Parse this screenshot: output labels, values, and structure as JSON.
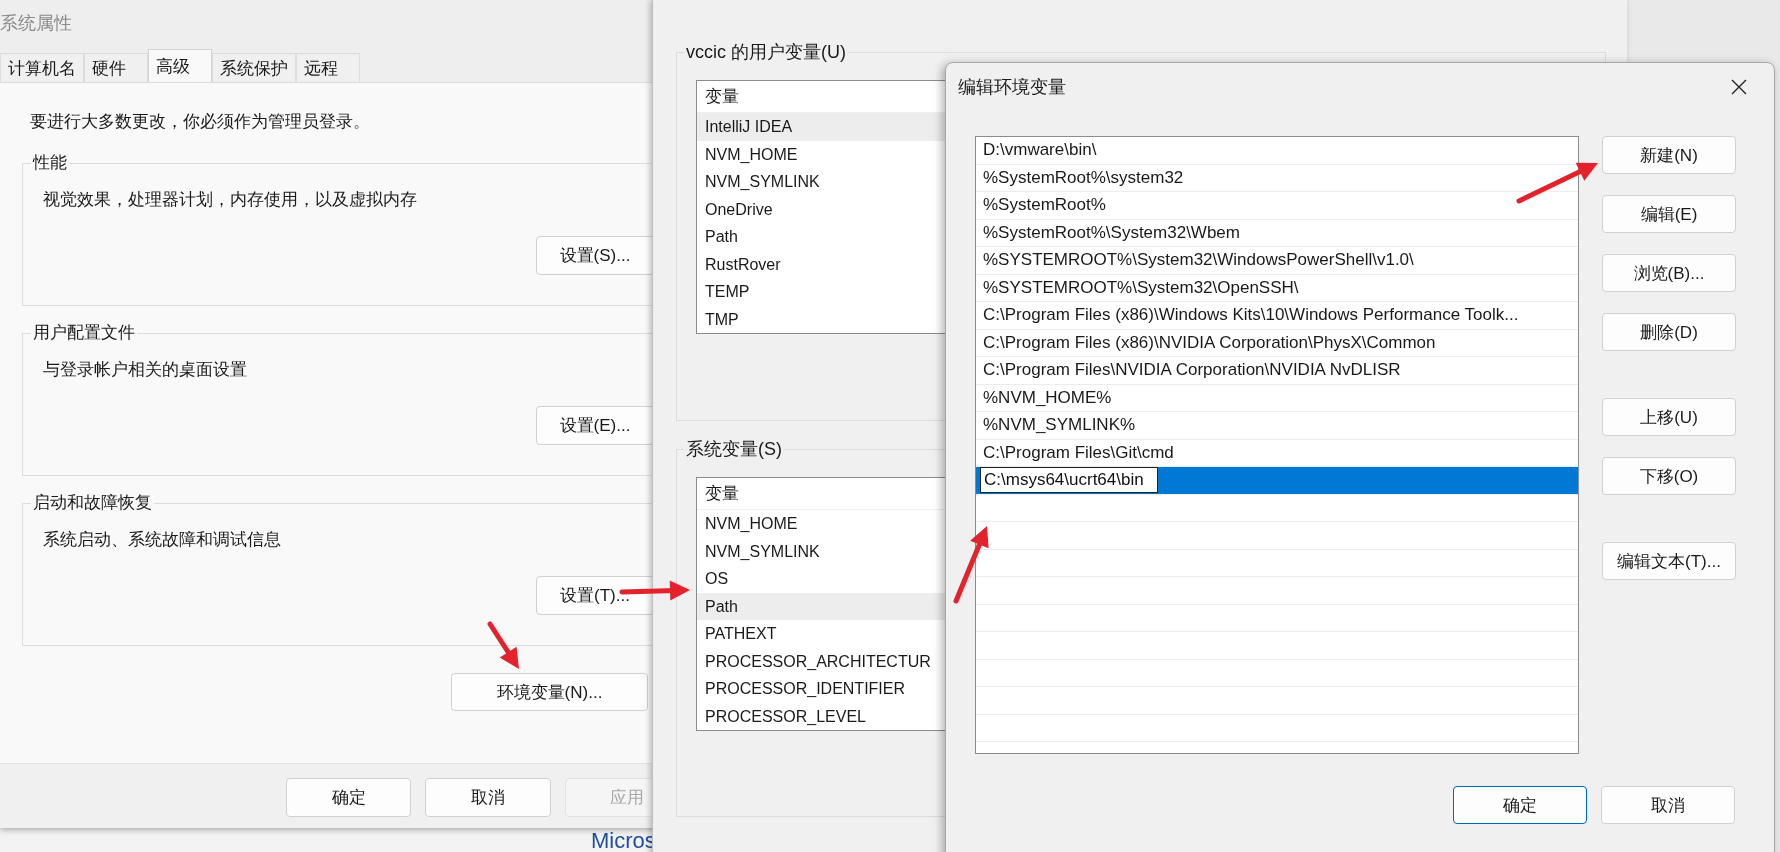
{
  "system_properties": {
    "title": "系统属性",
    "tabs": [
      {
        "label": "计算机名",
        "selected": false
      },
      {
        "label": "硬件",
        "selected": false
      },
      {
        "label": "高级",
        "selected": true
      },
      {
        "label": "系统保护",
        "selected": false
      },
      {
        "label": "远程",
        "selected": false
      }
    ],
    "notice": "要进行大多数更改，你必须作为管理员登录。",
    "groups": [
      {
        "label": "性能",
        "description": "视觉效果，处理器计划，内存使用，以及虚拟内存",
        "button": "设置(S)..."
      },
      {
        "label": "用户配置文件",
        "description": "与登录帐户相关的桌面设置",
        "button": "设置(E)..."
      },
      {
        "label": "启动和故障恢复",
        "description": "系统启动、系统故障和调试信息",
        "button": "设置(T)..."
      }
    ],
    "env_button": "环境变量(N)...",
    "buttons": [
      {
        "label": "确定",
        "disabled": false
      },
      {
        "label": "取消",
        "disabled": false
      },
      {
        "label": "应用",
        "disabled": true
      }
    ]
  },
  "environment_variables": {
    "user_group": "vccic 的用户变量(U)",
    "user_list": {
      "column": "变量",
      "rows": [
        {
          "name": "IntelliJ IDEA",
          "selected": true
        },
        {
          "name": "NVM_HOME",
          "selected": false
        },
        {
          "name": "NVM_SYMLINK",
          "selected": false
        },
        {
          "name": "OneDrive",
          "selected": false
        },
        {
          "name": "Path",
          "selected": false
        },
        {
          "name": "RustRover",
          "selected": false
        },
        {
          "name": "TEMP",
          "selected": false
        },
        {
          "name": "TMP",
          "selected": false
        }
      ]
    },
    "system_group": "系统变量(S)",
    "system_list": {
      "column": "变量",
      "rows": [
        {
          "name": "NVM_HOME",
          "selected": false
        },
        {
          "name": "NVM_SYMLINK",
          "selected": false
        },
        {
          "name": "OS",
          "selected": false
        },
        {
          "name": "Path",
          "selected": true
        },
        {
          "name": "PATHEXT",
          "selected": false
        },
        {
          "name": "PROCESSOR_ARCHITECTUR",
          "selected": false
        },
        {
          "name": "PROCESSOR_IDENTIFIER",
          "selected": false
        },
        {
          "name": "PROCESSOR_LEVEL",
          "selected": false
        }
      ]
    }
  },
  "edit_dialog": {
    "title": "编辑环境变量",
    "entries": [
      {
        "value": "D:\\vmware\\bin\\",
        "selected": false,
        "editing": false
      },
      {
        "value": "%SystemRoot%\\system32",
        "selected": false,
        "editing": false
      },
      {
        "value": "%SystemRoot%",
        "selected": false,
        "editing": false
      },
      {
        "value": "%SystemRoot%\\System32\\Wbem",
        "selected": false,
        "editing": false
      },
      {
        "value": "%SYSTEMROOT%\\System32\\WindowsPowerShell\\v1.0\\",
        "selected": false,
        "editing": false
      },
      {
        "value": "%SYSTEMROOT%\\System32\\OpenSSH\\",
        "selected": false,
        "editing": false
      },
      {
        "value": "C:\\Program Files (x86)\\Windows Kits\\10\\Windows Performance Toolk...",
        "selected": false,
        "editing": false
      },
      {
        "value": "C:\\Program Files (x86)\\NVIDIA Corporation\\PhysX\\Common",
        "selected": false,
        "editing": false
      },
      {
        "value": "C:\\Program Files\\NVIDIA Corporation\\NVIDIA NvDLISR",
        "selected": false,
        "editing": false
      },
      {
        "value": "%NVM_HOME%",
        "selected": false,
        "editing": false
      },
      {
        "value": "%NVM_SYMLINK%",
        "selected": false,
        "editing": false
      },
      {
        "value": "C:\\Program Files\\Git\\cmd",
        "selected": false,
        "editing": false
      },
      {
        "value": "C:\\msys64\\ucrt64\\bin",
        "selected": true,
        "editing": true
      }
    ],
    "button_groups": [
      [
        "新建(N)",
        "编辑(E)",
        "浏览(B)...",
        "删除(D)"
      ],
      [
        "上移(U)",
        "下移(O)"
      ],
      [
        "编辑文本(T)..."
      ]
    ],
    "footer_buttons": [
      {
        "label": "确定",
        "default": true
      },
      {
        "label": "取消",
        "default": false
      }
    ]
  },
  "background": {
    "text": "Micros"
  }
}
